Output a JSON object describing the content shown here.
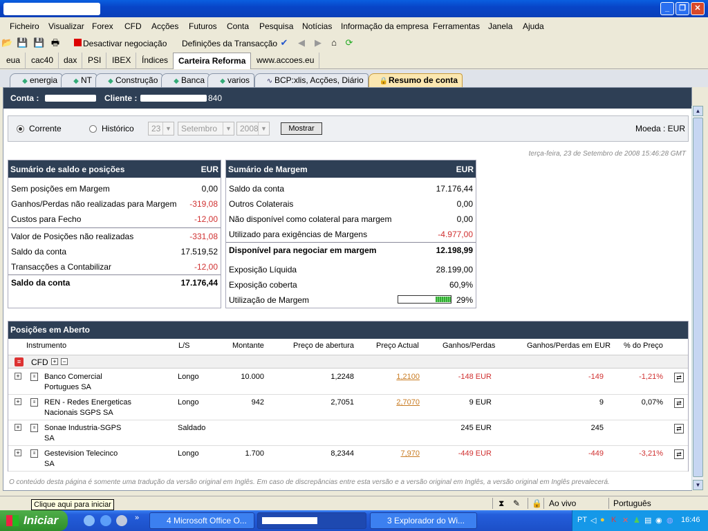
{
  "menu": [
    "Ficheiro",
    "Visualizar",
    "Forex",
    "CFD",
    "Acções",
    "Futuros",
    "Conta",
    "Pesquisa",
    "Notícias",
    "Informação da empresa",
    "Ferramentas",
    "Janela",
    "Ajuda"
  ],
  "toolbar": {
    "deactivate_label": "Desactivar negociação",
    "settings_label": "Definições da Transacção"
  },
  "workspace_tabs": [
    "eua",
    "cac40",
    "dax",
    "PSI",
    "IBEX",
    "Índices",
    "Carteira Reforma",
    "www.accoes.eu"
  ],
  "sub_tabs": [
    "energia",
    "NT",
    "Construção",
    "Banca",
    "varios",
    "BCP:xlis, Acções, Diário",
    "Resumo de conta"
  ],
  "account": {
    "conta_label": "Conta :",
    "cliente_label": "Cliente :",
    "cliente_suffix": "840"
  },
  "filter": {
    "corrente": "Corrente",
    "historico": "Histórico",
    "day": "23",
    "month": "Setembro",
    "year": "2008",
    "show_button": "Mostrar",
    "currency": "Moeda : EUR"
  },
  "timestamp": "terça-feira, 23 de Setembro de 2008 15:46:28 GMT",
  "balance": {
    "title": "Sumário de saldo e posições",
    "currency": "EUR",
    "rows": [
      {
        "label": "Sem posições em Margem",
        "value": "0,00"
      },
      {
        "label": "Ganhos/Perdas não realizadas para Margem",
        "value": "-319,08"
      },
      {
        "label": "Custos para Fecho",
        "value": "-12,00"
      },
      {
        "label": "Valor de Posições não realizadas",
        "value": "-331,08"
      },
      {
        "label": "Saldo da conta",
        "value": "17.519,52"
      },
      {
        "label": "Transacções a Contabilizar",
        "value": "-12,00"
      },
      {
        "label": "Saldo da conta",
        "value": "17.176,44"
      }
    ]
  },
  "margin": {
    "title": "Sumário de Margem",
    "currency": "EUR",
    "rows": [
      {
        "label": "Saldo da conta",
        "value": "17.176,44"
      },
      {
        "label": "Outros Colaterais",
        "value": "0,00"
      },
      {
        "label": "Não disponível como colateral para margem",
        "value": "0,00"
      },
      {
        "label": "Utilizado para exigências de Margens",
        "value": "-4.977,00"
      },
      {
        "label": "Disponível para negociar em margem",
        "value": "12.198,99"
      },
      {
        "label": "Exposição Líquida",
        "value": "28.199,00"
      },
      {
        "label": "Exposição coberta",
        "value": "60,9%"
      },
      {
        "label": "Utilização de Margem",
        "value": "29%"
      }
    ],
    "utilization_fraction": 0.29
  },
  "positions": {
    "title": "Posições em Aberto",
    "columns": [
      "Instrumento",
      "L/S",
      "Montante",
      "Preço de abertura",
      "Preço Actual",
      "Ganhos/Perdas",
      "Ganhos/Perdas em EUR",
      "% do Preço"
    ],
    "group": "CFD",
    "rows": [
      {
        "name1": "Banco Comercial",
        "name2": "Portugues SA",
        "ls": "Longo",
        "amount": "10.000",
        "open": "1,2248",
        "current": "1,2100",
        "pl": "-148 EUR",
        "pl_eur": "-149",
        "pct": "-1,21%"
      },
      {
        "name1": "REN - Redes Energeticas",
        "name2": "Nacionais SGPS SA",
        "ls": "Longo",
        "amount": "942",
        "open": "2,7051",
        "current": "2,7070",
        "pl": "9 EUR",
        "pl_eur": "9",
        "pct": "0,07%"
      },
      {
        "name1": "Sonae Industria-SGPS",
        "name2": "SA",
        "ls": "Saldado",
        "amount": "",
        "open": "",
        "current": "",
        "pl": "245 EUR",
        "pl_eur": "245",
        "pct": ""
      },
      {
        "name1": "Gestevision Telecinco",
        "name2": "SA",
        "ls": "Longo",
        "amount": "1.700",
        "open": "8,2344",
        "current": "7,970",
        "pl": "-449 EUR",
        "pl_eur": "-449",
        "pct": "-3,21%"
      }
    ]
  },
  "footer": "O conteúdo desta página é somente uma tradução da versão original em Inglês. Em caso de discrepâncias entre esta versão e a versão original em Inglês, a versão original em Inglês prevalecerá.",
  "status": {
    "tooltip": "Clique aqui para iniciar",
    "live": "Ao vivo",
    "language": "Português"
  },
  "taskbar": {
    "start": "Iniciar",
    "task1": "4 Microsoft Office O...",
    "task3": "3 Explorador do Wi...",
    "lang": "PT",
    "clock": "16:46"
  }
}
